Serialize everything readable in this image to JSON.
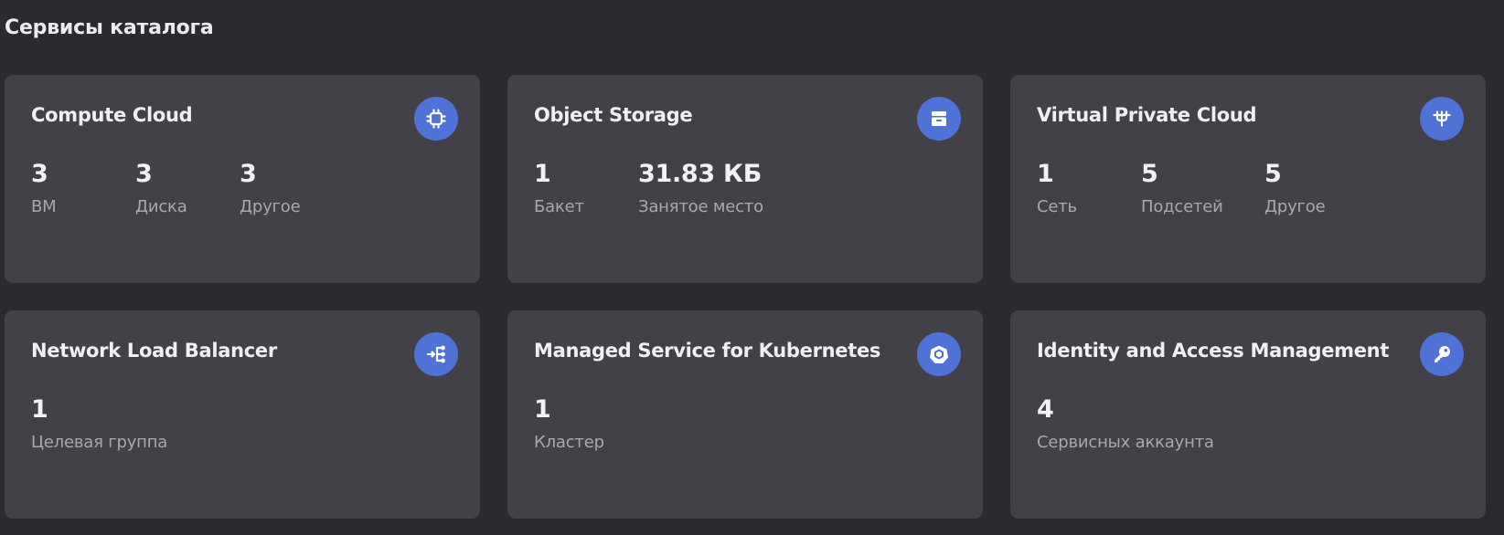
{
  "section": {
    "title": "Сервисы каталога"
  },
  "colors": {
    "background": "#2b2a30",
    "card": "#424147",
    "icon_accent": "#4f72d6"
  },
  "cards": [
    {
      "title": "Compute Cloud",
      "icon": "cpu-chip-icon",
      "stats": [
        {
          "value": "3",
          "label": "ВМ"
        },
        {
          "value": "3",
          "label": "Диска"
        },
        {
          "value": "3",
          "label": "Другое"
        }
      ]
    },
    {
      "title": "Object Storage",
      "icon": "storage-box-icon",
      "stats": [
        {
          "value": "1",
          "label": "Бакет"
        },
        {
          "value": "31.83 КБ",
          "label": "Занятое место"
        }
      ]
    },
    {
      "title": "Virtual Private Cloud",
      "icon": "network-icon",
      "stats": [
        {
          "value": "1",
          "label": "Сеть"
        },
        {
          "value": "5",
          "label": "Подсетей"
        },
        {
          "value": "5",
          "label": "Другое"
        }
      ]
    },
    {
      "title": "Network Load Balancer",
      "icon": "load-balancer-icon",
      "stats": [
        {
          "value": "1",
          "label": "Целевая группа"
        }
      ]
    },
    {
      "title": "Managed Service for Kubernetes",
      "icon": "kubernetes-icon",
      "stats": [
        {
          "value": "1",
          "label": "Кластер"
        }
      ]
    },
    {
      "title": "Identity and Access Management",
      "icon": "key-icon",
      "stats": [
        {
          "value": "4",
          "label": "Сервисных аккаунта"
        }
      ]
    }
  ]
}
